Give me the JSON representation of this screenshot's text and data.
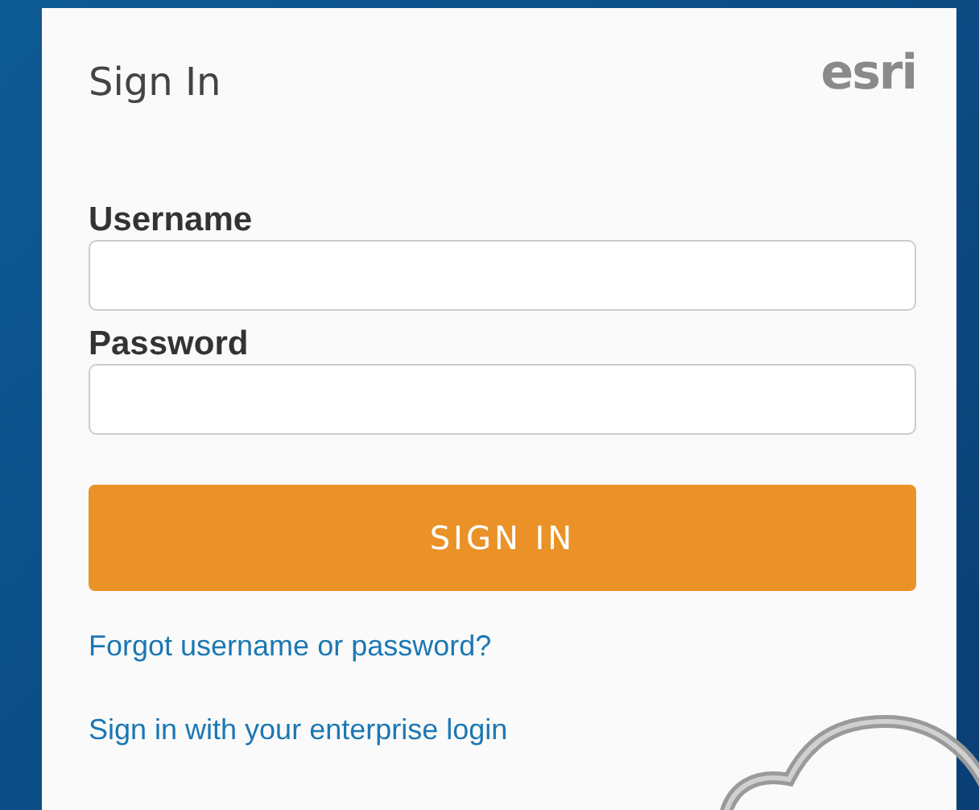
{
  "dialog": {
    "title": "Sign In",
    "logo": "esri"
  },
  "fields": [
    {
      "label": "Username"
    },
    {
      "label": "Password"
    }
  ],
  "button": "SIGN IN",
  "links": [
    "Forgot username or password?",
    "Sign in with your enterprise login"
  ]
}
